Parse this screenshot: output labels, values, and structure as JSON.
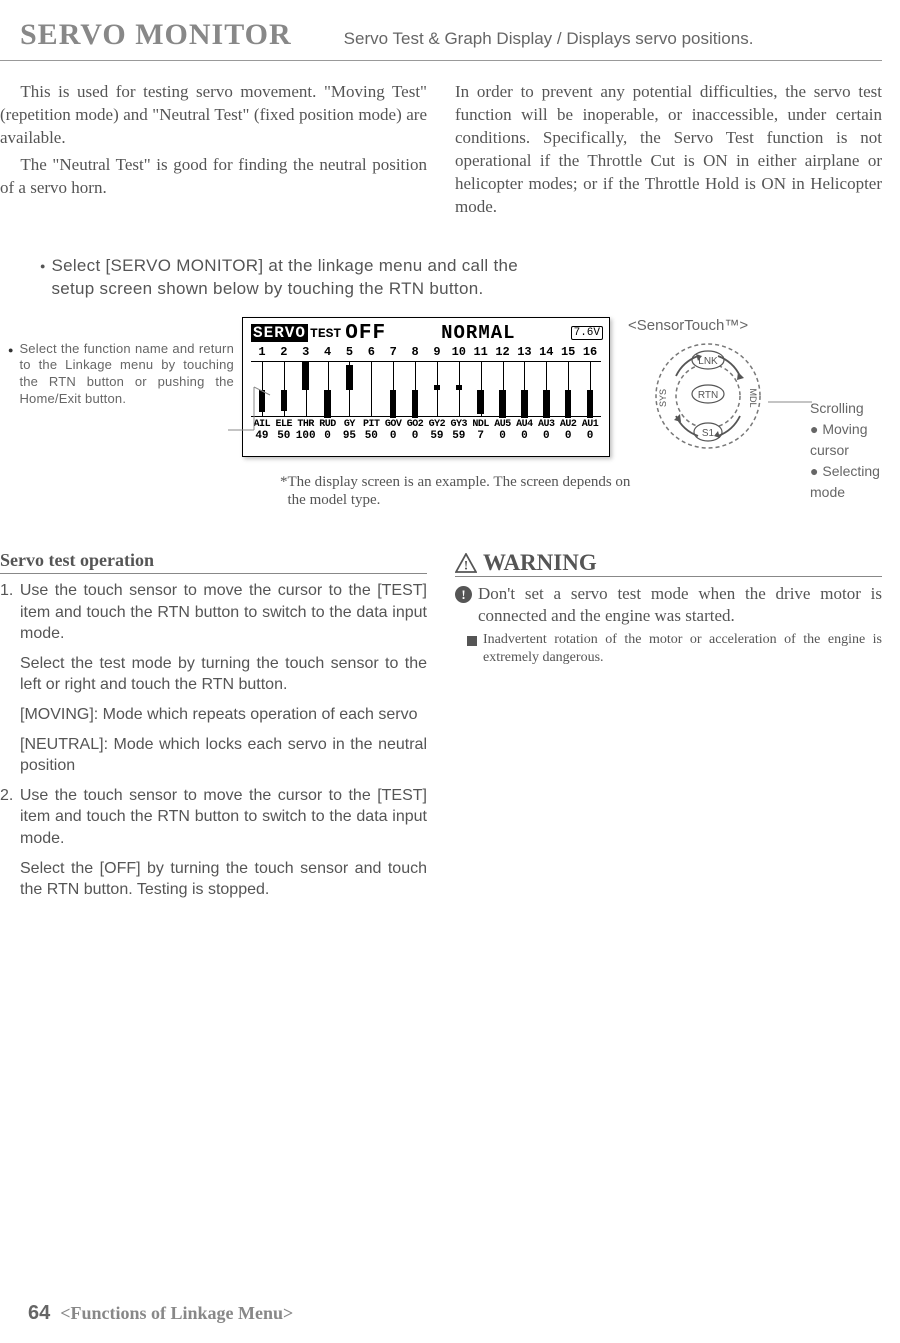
{
  "header": {
    "title": "SERVO MONITOR",
    "subtitle": "Servo Test & Graph Display / Displays servo positions."
  },
  "intro": {
    "p1": "This is used for testing servo movement. \"Moving Test\" (repetition mode) and \"Neutral Test\" (fixed position mode) are available.",
    "p2": "The \"Neutral Test\" is good for finding the neutral position of a servo horn.",
    "p3": "In order to prevent any potential difficulties, the servo test function will be inoperable, or inaccessible, under certain conditions.  Specifically, the Servo Test function is not operational if the Throttle Cut is ON in either airplane or helicopter modes; or if the Throttle Hold is ON in Helicopter mode."
  },
  "setup_note": "Select [SERVO MONITOR] at the linkage menu and call the setup screen shown below by touching the RTN button.",
  "left_note": "Select the function name and return to the Linkage menu by touching the RTN button or pushing the Home/Exit button.",
  "lcd": {
    "servo": "SERVO",
    "test": "TEST",
    "off": "OFF",
    "normal": "NORMAL",
    "battery": "7.6V",
    "numbers": [
      "1",
      "2",
      "3",
      "4",
      "5",
      "6",
      "7",
      "8",
      "9",
      "10",
      "11",
      "12",
      "13",
      "14",
      "15",
      "16"
    ],
    "labels": [
      "AIL",
      "ELE",
      "THR",
      "RUD",
      "GY",
      "PIT",
      "GOV",
      "GO2",
      "GY2",
      "GY3",
      "NDL",
      "AU5",
      "AU4",
      "AU3",
      "AU2",
      "AU1"
    ],
    "values": [
      "49",
      "50",
      "100",
      "0",
      "95",
      "50",
      "0",
      "0",
      "59",
      "59",
      "7",
      "0",
      "0",
      "0",
      "0",
      "0"
    ],
    "bar_offsets": [
      22,
      21,
      -28,
      28,
      -25,
      0,
      28,
      28,
      -5,
      -5,
      24,
      28,
      28,
      28,
      28,
      28
    ]
  },
  "sensor": {
    "label": "<SensorTouch™>",
    "scrolling": "Scrolling",
    "moving": "Moving cursor",
    "selecting": "Selecting mode",
    "lnk": "LNK",
    "rtn": "RTN",
    "sys": "SYS",
    "mdl": "MDL",
    "s1": "S1"
  },
  "footnote": "*The display screen is an example. The screen depends on the model type.",
  "operation": {
    "heading": "Servo test operation",
    "p1": "1. Use the touch sensor to move the cursor to the [TEST] item and touch the RTN button to switch to the data input mode.",
    "p2": "Select the test mode by turning the touch sensor to the left or right and touch the RTN button.",
    "p3": "[MOVING]: Mode which repeats operation of each servo",
    "p4": "[NEUTRAL]: Mode which locks each servo in the neutral position",
    "p5": "2. Use the touch sensor to move the cursor to the [TEST] item and touch the RTN button to switch to the data input mode.",
    "p6": "Select the [OFF] by turning the touch sensor and touch the RTN button. Testing is stopped."
  },
  "warning": {
    "heading": "WARNING",
    "main": "Don't set a servo test mode when the drive motor is connected and the engine was started.",
    "sub": "Inadvertent rotation of the motor or acceleration of the engine is extremely dangerous."
  },
  "footer": {
    "page": "64",
    "label": "<Functions of Linkage Menu>"
  }
}
